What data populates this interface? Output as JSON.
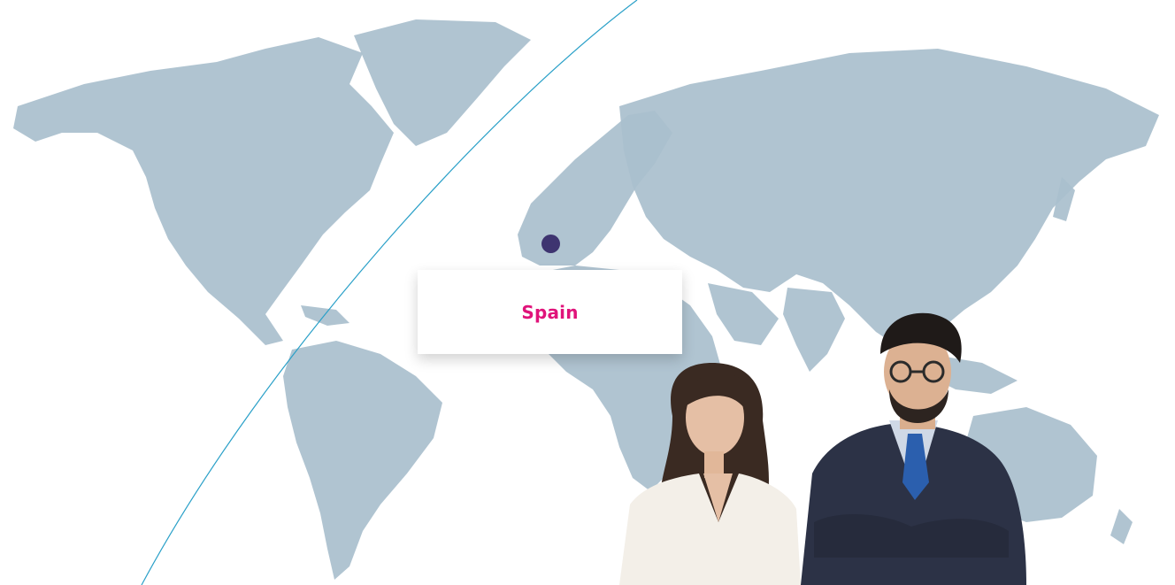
{
  "map": {
    "selected_country": "Spain",
    "marker_color": "#3e3470",
    "label_color": "#e0137a",
    "land_color": "#a9bfcd",
    "arc_color": "#2aa0c8"
  },
  "people": [
    {
      "name": "woman-in-white-blazer"
    },
    {
      "name": "man-in-navy-suit"
    }
  ]
}
